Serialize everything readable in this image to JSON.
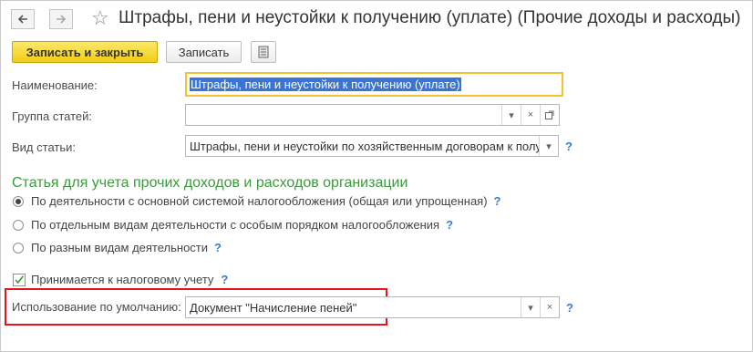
{
  "window": {
    "title": "Штрафы, пени и неустойки к получению (уплате) (Прочие доходы и расходы)"
  },
  "toolbar": {
    "save_close_label": "Записать и закрыть",
    "save_label": "Записать"
  },
  "form": {
    "name": {
      "label": "Наименование:",
      "value": "Штрафы, пени и неустойки к получению (уплате)"
    },
    "group": {
      "label": "Группа статей:",
      "value": ""
    },
    "kind": {
      "label": "Вид статьи:",
      "value": "Штрафы, пени и неустойки по хозяйственным договорам к полу"
    },
    "section_title": "Статья для учета прочих доходов и расходов организации",
    "radio_options": [
      {
        "label": "По деятельности с основной системой налогообложения (общая или упрощенная)",
        "selected": true
      },
      {
        "label": "По отдельным видам деятельности с особым порядком налогообложения",
        "selected": false
      },
      {
        "label": "По разным видам деятельности",
        "selected": false
      }
    ],
    "tax_accounting": {
      "label": "Принимается к налоговому учету",
      "checked": true
    },
    "default_usage": {
      "label": "Использование по умолчанию:",
      "value": "Документ \"Начисление пеней\""
    },
    "help_mark": "?"
  },
  "colors": {
    "primary_button": "#f2cd1a",
    "section_title": "#3a9c3a",
    "help": "#3a7bd5",
    "focus_border": "#f3c430",
    "highlight_frame": "#e8141b"
  }
}
